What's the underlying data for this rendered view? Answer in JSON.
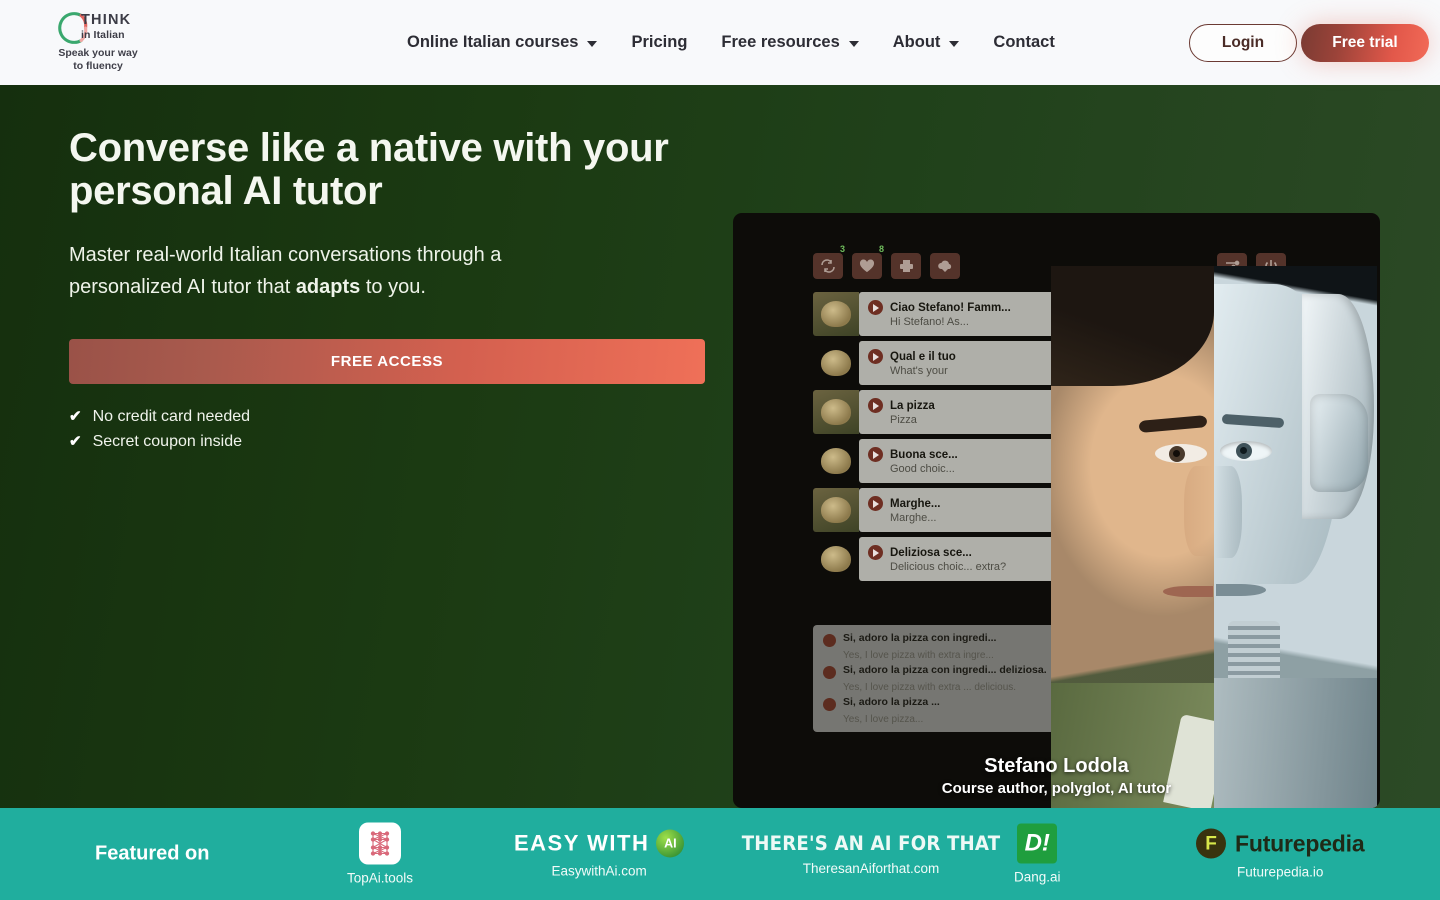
{
  "header": {
    "logo": {
      "think": "THINK",
      "in_italian": "in Italian",
      "tagline": "Speak your way\nto fluency",
      "tagline_line1": "Speak your way",
      "tagline_line2": "to fluency"
    },
    "nav": [
      {
        "label": "Online Italian courses",
        "has_dropdown": true
      },
      {
        "label": "Pricing",
        "has_dropdown": false
      },
      {
        "label": "Free resources",
        "has_dropdown": true
      },
      {
        "label": "About",
        "has_dropdown": true
      },
      {
        "label": "Contact",
        "has_dropdown": false
      }
    ],
    "login_label": "Login",
    "trial_label": "Free trial"
  },
  "hero": {
    "heading": "Converse like a native with your personal AI tutor",
    "sub_part1": "Master real-world Italian conversations through a personalized AI tutor that ",
    "sub_bold": "adapts",
    "sub_part2": " to you.",
    "cta_label": "FREE ACCESS",
    "checks": [
      {
        "mark": "check-icon",
        "label": "No credit card needed"
      },
      {
        "mark": "check-icon",
        "label": "Secret coupon inside"
      }
    ]
  },
  "video": {
    "toolbar": [
      {
        "icon": "repeat-icon",
        "badge": "3"
      },
      {
        "icon": "heart-icon",
        "badge": "8"
      },
      {
        "icon": "printer-icon",
        "badge": ""
      },
      {
        "icon": "download-cloud-icon",
        "badge": ""
      }
    ],
    "controls": [
      {
        "icon": "sliders-icon"
      },
      {
        "icon": "power-icon"
      }
    ],
    "mic_icon": "microphone-icon",
    "messages": [
      {
        "italian": "Ciao Stefano! Famm...",
        "english": "Hi Stefano! As...",
        "avatar": true,
        "thumb": false
      },
      {
        "italian": "Qual e il tuo",
        "english": "What's your",
        "avatar": false,
        "thumb": true
      },
      {
        "italian": "La pizza",
        "english": "Pizza",
        "avatar": true,
        "thumb": false
      },
      {
        "italian": "Buona sce...",
        "english": "Good choic...",
        "avatar": false,
        "thumb": true
      },
      {
        "italian": "Marghe...",
        "english": "Marghe...",
        "avatar": true,
        "thumb": false
      },
      {
        "italian": "Deliziosa sce...",
        "english": "Delicious choic... extra?",
        "avatar": false,
        "thumb": true
      }
    ],
    "conversation": [
      {
        "italian": "Si, adoro la pizza con ingredi...",
        "english": "Yes, I love pizza with extra ingre..."
      },
      {
        "italian": "Si, adoro la pizza con ingredi... deliziosa.",
        "english": "Yes, I love pizza with extra ... delicious."
      },
      {
        "italian": "Si, adoro la pizza ...",
        "english": "Yes, I love pizza..."
      }
    ],
    "caption_name": "Stefano Lodola",
    "caption_role": "Course author, polyglot, AI tutor"
  },
  "featured": {
    "label": "Featured on",
    "items": [
      {
        "name": "TopAi.tools",
        "logo_text": "",
        "logo_kind": "topai-network-icon"
      },
      {
        "name": "EasywithAi.com",
        "logo_text": "EASY WITH",
        "badge": "AI",
        "logo_kind": "easywithai-logo"
      },
      {
        "name": "TheresanAiforthat.com",
        "logo_text": "THERE'S AN AI FOR THAT",
        "logo_kind": "theresanaiforthat-logo"
      },
      {
        "name": "Dang.ai",
        "logo_text": "D!",
        "logo_kind": "dangai-logo"
      },
      {
        "name": "Futurepedia.io",
        "logo_text": "Futurepedia",
        "mark": "F",
        "logo_kind": "futurepedia-logo"
      }
    ]
  },
  "colors": {
    "hero_green_dark": "#152f0e",
    "hero_green_light": "#2c4a26",
    "accent_coral": "#ef7058",
    "accent_dark_red": "#9a5248",
    "teal_bar": "#20ae9e",
    "header_bg": "#f8f9fb",
    "badge_green": "#6fbd5c"
  }
}
